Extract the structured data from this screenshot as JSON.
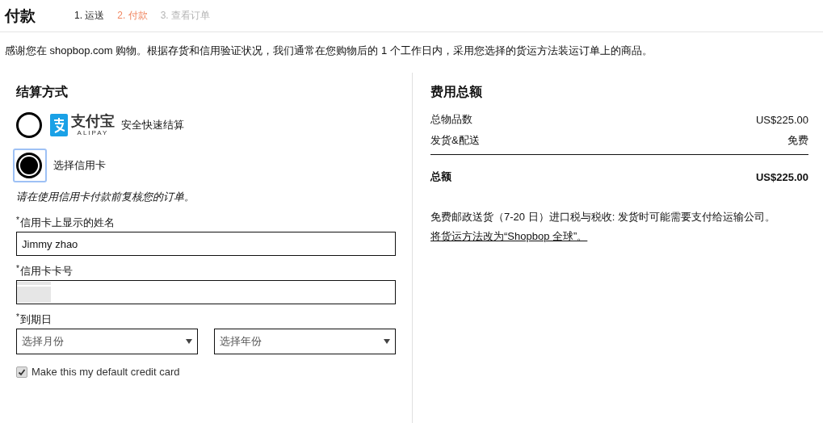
{
  "header": {
    "title": "付款",
    "steps": [
      {
        "label": "1. 运送",
        "completed": true,
        "selected": false
      },
      {
        "label": "2. 付款",
        "completed": false,
        "selected": true
      },
      {
        "label": "3. 查看订单",
        "completed": false,
        "selected": false
      }
    ]
  },
  "intro": "感谢您在 shopbop.com 购物。根据存货和信用验证状况，我们通常在您购物后的 1 个工作日内，采用您选择的货运方法装运订单上的商品。",
  "payment": {
    "heading": "结算方式",
    "options": [
      {
        "kind": "alipay",
        "logo_text": "支付宝",
        "logo_subtext": "ALIPAY",
        "label": "安全快速结算",
        "selected": false
      },
      {
        "kind": "plain",
        "label": "选择信用卡",
        "selected": true
      }
    ],
    "note": "请在使用信用卡付款前复核您的订单。",
    "fields": [
      {
        "kind": "text",
        "label": "信用卡上显示的姓名",
        "required_mark": "*",
        "value": "Jimmy zhao"
      },
      {
        "kind": "redacted",
        "label": "信用卡卡号",
        "required_mark": "*"
      },
      {
        "kind": "selects",
        "label": "到期日",
        "required_mark": "*",
        "selects": [
          {
            "placeholder": "选择月份"
          },
          {
            "placeholder": "选择年份"
          }
        ]
      }
    ],
    "default_card": {
      "label": "Make this my default credit card",
      "checked": true
    }
  },
  "summary": {
    "heading": "费用总额",
    "rows": [
      {
        "label": "总物品数",
        "value": "US$225.00"
      },
      {
        "label": "发货&配送",
        "value": "免费"
      }
    ],
    "total": {
      "label": "总额",
      "value": "US$225.00"
    },
    "shipping_note": "免费邮政送货（7-20 日）进口税与税收: 发货时可能需要支付给运输公司。",
    "change_link": "将货运方法改为“Shopbop 全球”。"
  }
}
